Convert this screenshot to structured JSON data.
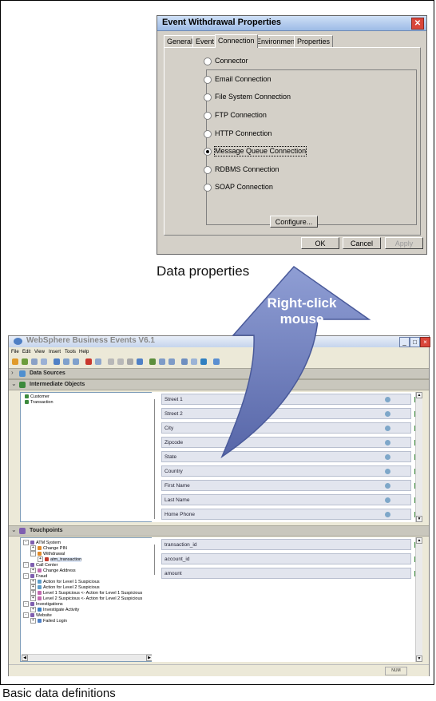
{
  "dialog": {
    "title": "Event Withdrawal Properties",
    "close_glyph": "✕",
    "tabs": [
      "General",
      "Event",
      "Connection",
      "Environment",
      "Properties"
    ],
    "active_tab": "Connection",
    "options": [
      {
        "label": "Connector",
        "selected": false
      },
      {
        "label": "Email Connection",
        "selected": false
      },
      {
        "label": "File System Connection",
        "selected": false
      },
      {
        "label": "FTP Connection",
        "selected": false
      },
      {
        "label": "HTTP Connection",
        "selected": false
      },
      {
        "label": "Message Queue Connection",
        "selected": true
      },
      {
        "label": "RDBMS Connection",
        "selected": false
      },
      {
        "label": "SOAP Connection",
        "selected": false
      }
    ],
    "configure_label": "Configure...",
    "ok_label": "OK",
    "cancel_label": "Cancel",
    "apply_label": "Apply"
  },
  "captions": {
    "top": "Data properties",
    "bottom": "Basic data definitions"
  },
  "arrow": {
    "text_line1": "Right-click",
    "text_line2": "mouse"
  },
  "app": {
    "title": "WebSphere Business Events V6.1",
    "menu": [
      "File",
      "Edit",
      "View",
      "Insert",
      "Tools",
      "Help"
    ],
    "sections": {
      "data_sources": "Data Sources",
      "intermediate_objects": "Intermediate Objects",
      "touchpoints": "Touchpoints"
    },
    "intermediate_tree": [
      "Customer",
      "Transaction"
    ],
    "intermediate_fields": [
      "Street 1",
      "Street 2",
      "City",
      "Zipcode",
      "State",
      "Country",
      "First Name",
      "Last Name",
      "Home Phone"
    ],
    "touchpoint_tree": [
      {
        "label": "ATM System",
        "level": 0
      },
      {
        "label": "Change PIN",
        "level": 1
      },
      {
        "label": "Withdrawal",
        "level": 1
      },
      {
        "label": "atm_transaction",
        "level": 2
      },
      {
        "label": "Call Center",
        "level": 0
      },
      {
        "label": "Change Address",
        "level": 1
      },
      {
        "label": "Fraud",
        "level": 0
      },
      {
        "label": "Action for Level 1 Suspicious",
        "level": 1
      },
      {
        "label": "Action for Level 2 Suspicious",
        "level": 1
      },
      {
        "label": "Level 1 Suspicious <- Action for Level 1 Suspicious",
        "level": 1
      },
      {
        "label": "Level 2 Suspicious <- Action for Level 2 Suspicious",
        "level": 1
      },
      {
        "label": "Investigations",
        "level": 0
      },
      {
        "label": "Investigate Activity",
        "level": 1
      },
      {
        "label": "Website",
        "level": 0
      },
      {
        "label": "Failed Login",
        "level": 1
      }
    ],
    "touchpoint_fields": [
      "transaction_id",
      "account_id",
      "amount"
    ],
    "status_num": "NUM"
  },
  "colors": {
    "arrow_fill": "#6e7fbd",
    "arrow_text": "#ffffff",
    "titlebar": "#c5d4ec"
  }
}
